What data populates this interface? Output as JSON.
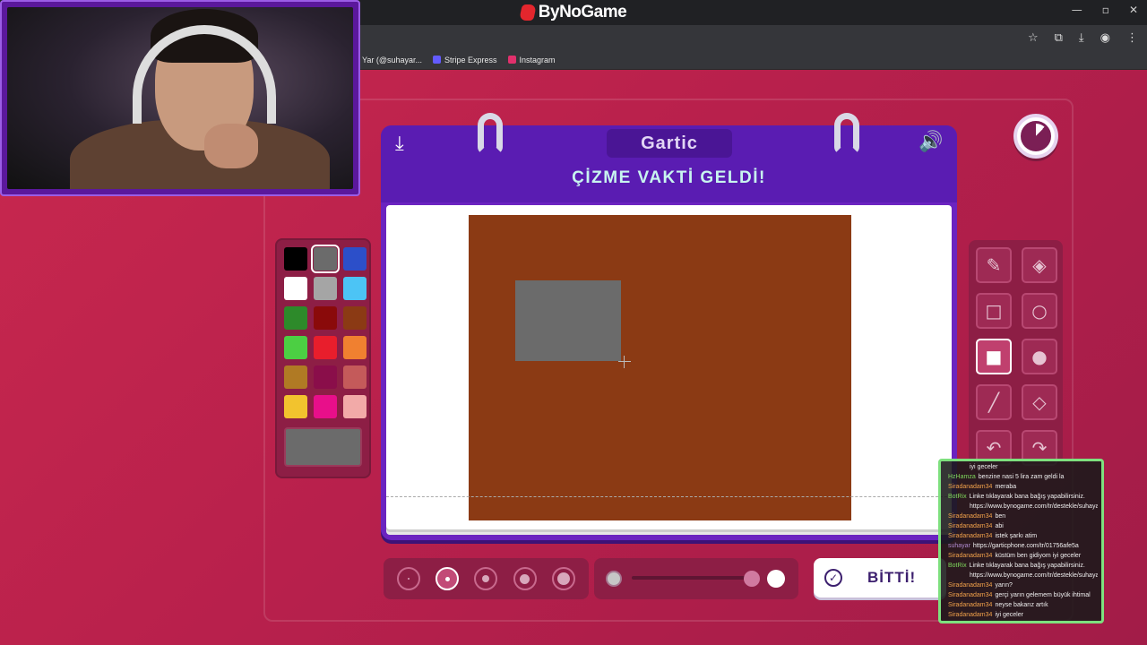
{
  "browser": {
    "site_name": "ByNoGame",
    "bookmarks": [
      {
        "label": "Yar (@suhayar...",
        "color": "#35363a"
      },
      {
        "label": "Stripe Express",
        "color": "#635bff"
      },
      {
        "label": "Instagram",
        "color": "#e1306c"
      }
    ]
  },
  "game": {
    "brand": "Gartic",
    "title": "ÇİZME VAKTİ GELDİ!",
    "download_icon": "download-icon",
    "sound_icon": "speaker-icon",
    "timer_icon": "timer-icon",
    "done_label": "BİTTİ!"
  },
  "palette": {
    "colors": [
      "#000000",
      "#6b6b6b",
      "#2c4fc9",
      "#ffffff",
      "#a5a5a5",
      "#4cc4f5",
      "#2d8a2a",
      "#8a0a0a",
      "#8b3a14",
      "#4ccf43",
      "#e81e2c",
      "#f08030",
      "#b07a24",
      "#8a0e4a",
      "#c45a5a",
      "#f2c32e",
      "#e80f8a",
      "#f2aaa8"
    ],
    "selected_index": 1,
    "current_color": "#6b6b6b"
  },
  "tools": [
    {
      "name": "pencil-tool",
      "icon": "✎"
    },
    {
      "name": "eraser-tool",
      "icon": "◈"
    },
    {
      "name": "rectangle-outline-tool",
      "icon": "□"
    },
    {
      "name": "circle-outline-tool",
      "icon": "○"
    },
    {
      "name": "rectangle-fill-tool",
      "icon": "■"
    },
    {
      "name": "circle-fill-tool",
      "icon": "●"
    },
    {
      "name": "line-tool",
      "icon": "╱"
    },
    {
      "name": "fill-bucket-tool",
      "icon": "◇"
    },
    {
      "name": "undo-tool",
      "icon": "↶"
    },
    {
      "name": "redo-tool",
      "icon": "↷"
    }
  ],
  "active_tool_index": 4,
  "canvas": {
    "background": "#8b3a14",
    "shape_color": "#6b6b6b"
  },
  "brush_sizes": {
    "count": 5,
    "selected_index": 1
  },
  "opacity": {
    "value": 1
  },
  "chat": [
    {
      "user": "",
      "msg": "iyi geceler",
      "color": "#f2a24b"
    },
    {
      "user": "HzHamza",
      "msg": "benzine nasi 5 lira zam geldi la",
      "color": "#7fd85c"
    },
    {
      "user": "Siradanadam34",
      "msg": "meraba",
      "color": "#f2a24b"
    },
    {
      "user": "BotRix",
      "msg": "Linke tıklayarak bana bağış yapabilirsiniz.",
      "color": "#7fd85c"
    },
    {
      "user": "",
      "msg": "https://www.bynogame.com/tr/destekle/suhayar",
      "color": "#7fd85c"
    },
    {
      "user": "Siradanadam34",
      "msg": "ben",
      "color": "#f2a24b"
    },
    {
      "user": "Siradanadam34",
      "msg": "abi",
      "color": "#f2a24b"
    },
    {
      "user": "Siradanadam34",
      "msg": "istek şarkı atim",
      "color": "#f2a24b"
    },
    {
      "user": "suhayar",
      "msg": "https://garticphone.com/tr/01756afe5a",
      "color": "#b08acf"
    },
    {
      "user": "Siradanadam34",
      "msg": "küstüm ben gidiyom iyi geceler",
      "color": "#f2a24b"
    },
    {
      "user": "BotRix",
      "msg": "Linke tıklayarak bana bağış yapabilirsiniz.",
      "color": "#7fd85c"
    },
    {
      "user": "",
      "msg": "https://www.bynogame.com/tr/destekle/suhayar",
      "color": "#7fd85c"
    },
    {
      "user": "Siradanadam34",
      "msg": "yarın?",
      "color": "#f2a24b"
    },
    {
      "user": "Siradanadam34",
      "msg": "gerçi yarın gelemem büyük ihtimal",
      "color": "#f2a24b"
    },
    {
      "user": "Siradanadam34",
      "msg": "neyse bakarız artık",
      "color": "#f2a24b"
    },
    {
      "user": "Siradanadam34",
      "msg": "iyi geceler",
      "color": "#f2a24b"
    }
  ]
}
